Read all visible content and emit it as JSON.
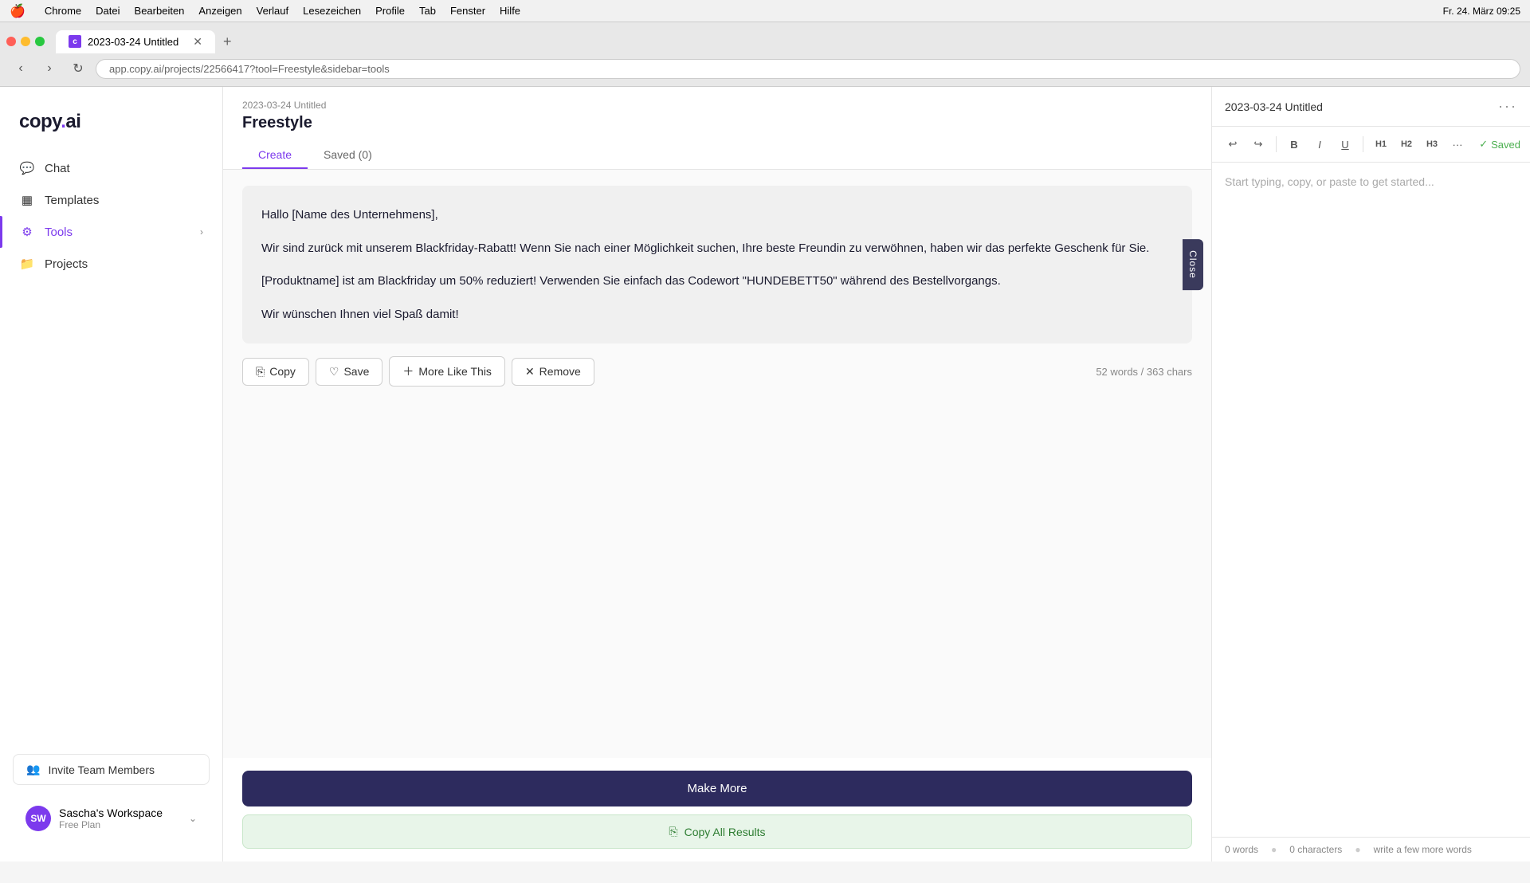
{
  "menubar": {
    "apple": "🍎",
    "items": [
      "Chrome",
      "Datei",
      "Bearbeiten",
      "Anzeigen",
      "Verlauf",
      "Lesezeichen",
      "Profile",
      "Tab",
      "Fenster",
      "Hilfe"
    ],
    "time": "Fr. 24. März  09:25"
  },
  "browser": {
    "tab_title": "2023-03-24 Untitled",
    "url": "app.copy.ai/projects/22566417?tool=Freestyle&sidebar=tools",
    "new_tab": "+"
  },
  "sidebar": {
    "logo": "copy.ai",
    "nav_items": [
      {
        "icon": "💬",
        "label": "Chat",
        "active": false
      },
      {
        "icon": "📋",
        "label": "Templates",
        "active": false
      },
      {
        "icon": "🛠️",
        "label": "Tools",
        "active": true,
        "hasChevron": true
      },
      {
        "icon": "📁",
        "label": "Projects",
        "active": false
      }
    ],
    "invite_btn": "Invite Team Members",
    "workspace": {
      "initials": "SW",
      "name": "Sascha's Workspace",
      "plan": "Free Plan"
    }
  },
  "header": {
    "breadcrumb": "2023-03-24 Untitled",
    "title": "Freestyle",
    "tabs": [
      {
        "label": "Create",
        "active": true
      },
      {
        "label": "Saved (0)",
        "active": false,
        "badge": "0"
      }
    ]
  },
  "result_card": {
    "paragraph1": "Hallo [Name des Unternehmens],",
    "paragraph2": "Wir sind zurück mit unserem Blackfriday-Rabatt! Wenn Sie nach einer Möglichkeit suchen, Ihre beste Freundin zu verwöhnen, haben wir das perfekte Geschenk für Sie.",
    "paragraph3": "[Produktname] ist am Blackfriday um 50% reduziert! Verwenden Sie einfach das Codewort \"HUNDEBETT50\" während des Bestellvorgangs.",
    "paragraph4": "Wir wünschen Ihnen viel Spaß damit!",
    "close_tab_label": "Close"
  },
  "action_bar": {
    "copy_label": "Copy",
    "save_label": "Save",
    "more_like_this_label": "More Like This",
    "remove_label": "Remove",
    "word_count": "52 words / 363 chars"
  },
  "bottom_actions": {
    "make_more": "Make More",
    "copy_all": "Copy All Results"
  },
  "editor": {
    "title": "2023-03-24 Untitled",
    "menu_dots": "···",
    "toolbar": {
      "undo": "↩",
      "redo": "↪",
      "bold": "B",
      "italic": "I",
      "underline": "U",
      "h1": "H1",
      "h2": "H2",
      "h3": "H3",
      "more": "···",
      "saved": "Saved"
    },
    "placeholder": "Start typing, copy, or paste to get started...",
    "footer": {
      "words": "0 words",
      "chars": "0 characters",
      "hint": "write a few more words"
    }
  },
  "icons": {
    "copy": "⎘",
    "save": "♡",
    "more": "＋",
    "remove": "✕",
    "copy_all": "⎘",
    "chat": "💬",
    "templates": "▦",
    "tools": "⚙",
    "projects": "▢",
    "invite": "👥",
    "check": "✓"
  }
}
